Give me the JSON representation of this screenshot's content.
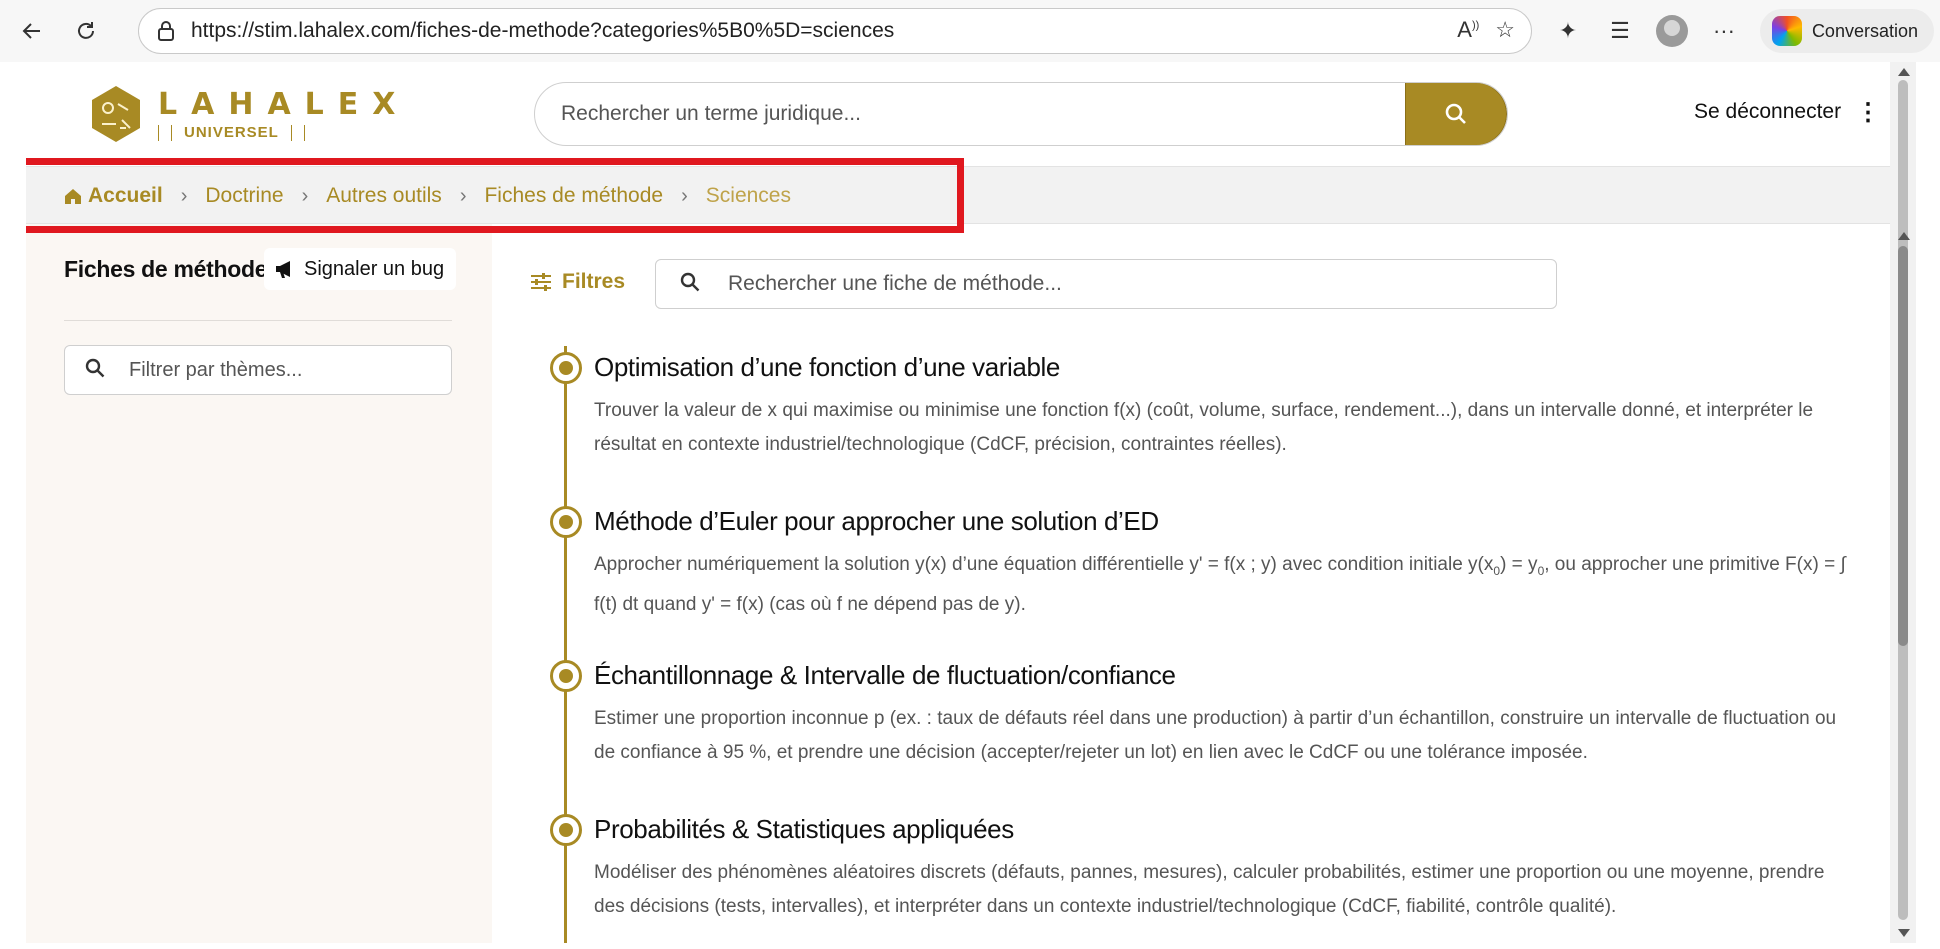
{
  "browser": {
    "url": "https://stim.lahalex.com/fiches-de-methode?categories%5B0%5D=sciences",
    "conversation_label": "Conversation"
  },
  "header": {
    "logo_line1": "LAHALEX",
    "logo_line2": "UNIVERSEL",
    "search_placeholder": "Rechercher un terme juridique...",
    "logout_label": "Se déconnecter"
  },
  "breadcrumb": {
    "home": "Accueil",
    "items": [
      "Doctrine",
      "Autres outils",
      "Fiches de méthode"
    ],
    "current": "Sciences"
  },
  "sidebar": {
    "title": "Fiches de méthode",
    "bug_button": "Signaler un bug",
    "filter_placeholder": "Filtrer par thèmes..."
  },
  "main": {
    "filters_label": "Filtres",
    "search_placeholder": "Rechercher une fiche de méthode...",
    "items": [
      {
        "title": "Optimisation d’une fonction d’une variable",
        "description": "Trouver la valeur de x qui maximise ou minimise une fonction f(x) (coût, volume, surface, rendement...), dans un intervalle donné, et interpréter le résultat en contexte industriel/technologique (CdCF, précision, contraintes réelles)."
      },
      {
        "title": "Méthode d’Euler pour approcher une solution d’ED",
        "description_a": "Approcher numériquement la solution y(x) d’une équation différentielle y' = f(x ; y) avec condition initiale y(x",
        "description_sub1": "0",
        "description_b": ") = y",
        "description_sub2": "0",
        "description_c": ", ou approcher une primitive F(x) = ∫ f(t) dt quand y' = f(x) (cas où f ne dépend pas de y)."
      },
      {
        "title": "Échantillonnage & Intervalle de fluctuation/confiance",
        "description": "Estimer une proportion inconnue p (ex. : taux de défauts réel dans une production) à partir d’un échantillon, construire un intervalle de fluctuation ou de confiance à 95 %, et prendre une décision (accepter/rejeter un lot) en lien avec le CdCF ou une tolérance imposée."
      },
      {
        "title": "Probabilités & Statistiques appliquées",
        "description": "Modéliser des phénomènes aléatoires discrets (défauts, pannes, mesures), calculer probabilités, estimer une proportion ou une moyenne, prendre des décisions (tests, intervalles), et interpréter dans un contexte industriel/technologique (CdCF, fiabilité, contrôle qualité)."
      }
    ]
  },
  "colors": {
    "accent": "#a88a24",
    "highlight_box": "#e0181f",
    "sidebar_bg": "#fbf7f3"
  }
}
